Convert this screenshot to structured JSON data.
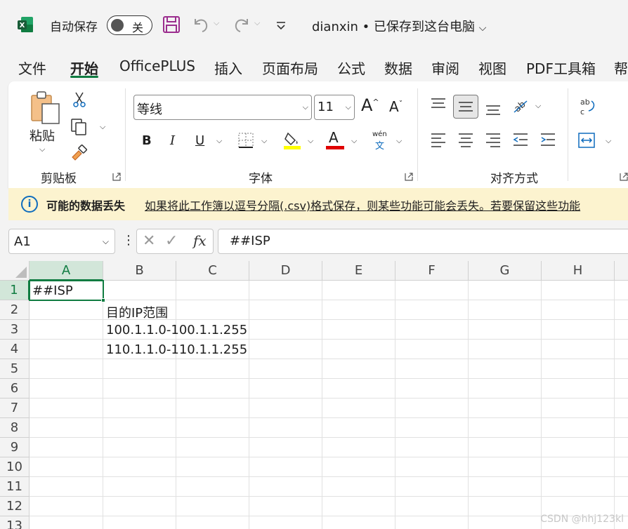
{
  "titlebar": {
    "autosave_label": "自动保存",
    "autosave_state": "关",
    "doc_name": "dianxin",
    "save_status": " • 已保存到这台电脑"
  },
  "tabs": [
    "文件",
    "开始",
    "OfficePLUS",
    "插入",
    "页面布局",
    "公式",
    "数据",
    "审阅",
    "视图",
    "PDF工具箱",
    "帮"
  ],
  "active_tab": "开始",
  "ribbon": {
    "clipboard": {
      "paste_label": "粘贴",
      "group_label": "剪贴板"
    },
    "font": {
      "font_name": "等线",
      "font_size": "11",
      "group_label": "字体",
      "phonetic": "wén",
      "phonetic_char": "文",
      "bold": "B",
      "italic": "I",
      "underline": "U",
      "font_color_letter": "A",
      "fill_color": "#ffff00",
      "text_color": "#e00000"
    },
    "alignment": {
      "group_label": "对齐方式"
    }
  },
  "infobar": {
    "title": "可能的数据丢失",
    "message": "如果将此工作簿以逗号分隔(.csv)格式保存，则某些功能可能会丢失。若要保留这些功能"
  },
  "formula_bar": {
    "name_box": "A1",
    "fx": "fx",
    "formula": "##ISP"
  },
  "sheet": {
    "columns": [
      "A",
      "B",
      "C",
      "D",
      "E",
      "F",
      "G",
      "H"
    ],
    "rows": [
      "1",
      "2",
      "3",
      "4",
      "5",
      "6",
      "7",
      "8",
      "9",
      "10",
      "11",
      "12",
      "13"
    ],
    "cells": {
      "A1": "##ISP",
      "B2": "目的IP范围",
      "B3": "100.1.1.0-100.1.1.255",
      "B4": "110.1.1.0-110.1.1.255"
    }
  },
  "watermark": "CSDN @hhj123kl",
  "colors": {
    "excel_green": "#107c41",
    "info_blue": "#0f6cbd",
    "infobar_bg": "#fcf3cf"
  }
}
